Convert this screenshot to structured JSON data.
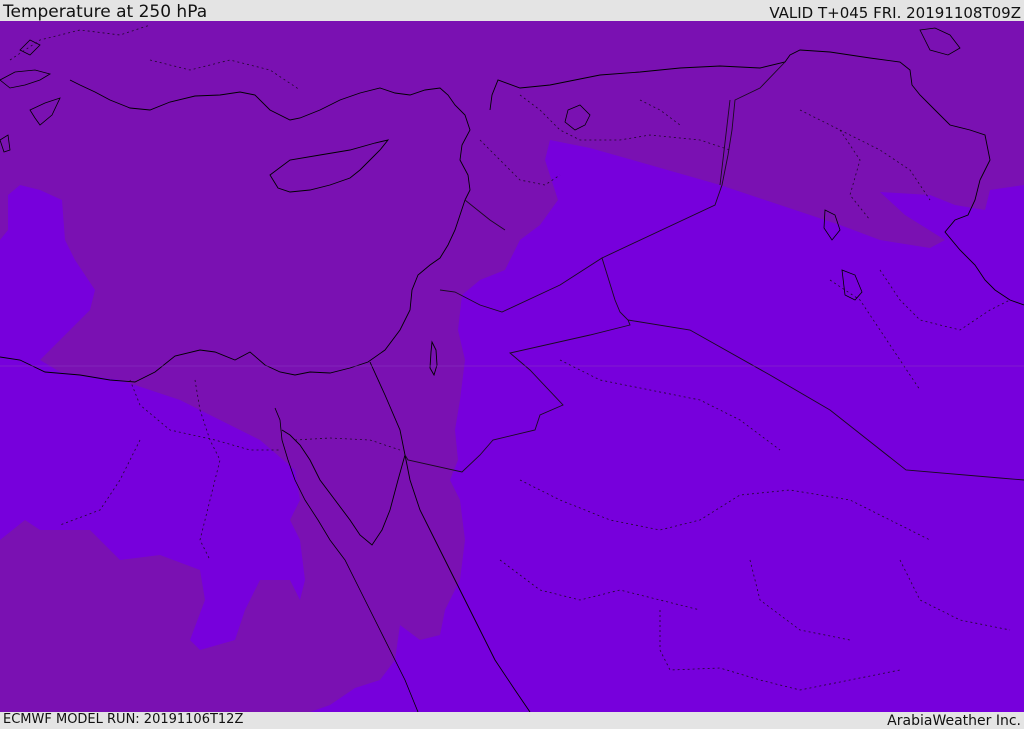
{
  "header": {
    "title": "Temperature at 250 hPa",
    "valid_time": "VALID T+045 FRI. 20191108T09Z"
  },
  "footer": {
    "model_run": "ECMWF MODEL RUN: 20191106T12Z",
    "credit": "ArabiaWeather Inc."
  },
  "map": {
    "colors": {
      "warm_band": "#7700dc",
      "cool_band": "#7a11b2",
      "coastline": "#000000",
      "border": "#1a0a20"
    }
  }
}
